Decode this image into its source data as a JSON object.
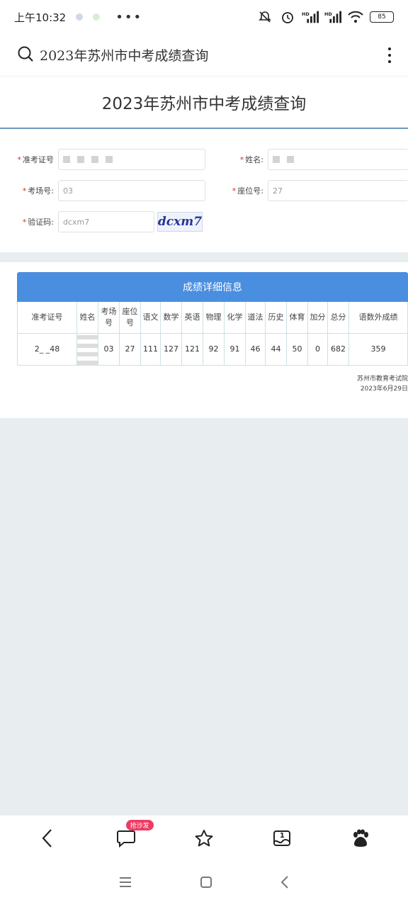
{
  "status": {
    "time": "上午10:32",
    "battery": "85"
  },
  "search": {
    "query": "2023年苏州市中考成绩查询"
  },
  "page": {
    "title": "2023年苏州市中考成绩查询"
  },
  "form": {
    "ticket_label": "准考证号",
    "name_label": "姓名:",
    "room_label": "考场号:",
    "room_value": "03",
    "seat_label": "座位号:",
    "seat_value": "27",
    "code_label": "验证码:",
    "code_value": "dcxm7",
    "captcha_text": "dcxm7",
    "required_mark": "*"
  },
  "result": {
    "header": "成绩详细信息",
    "columns": [
      {
        "label": "准考证号",
        "value": "2_ _48"
      },
      {
        "label": "姓名",
        "value": ""
      },
      {
        "label": "考场号",
        "value": "03"
      },
      {
        "label": "座位号",
        "value": "27"
      },
      {
        "label": "语文",
        "value": "111"
      },
      {
        "label": "数学",
        "value": "127"
      },
      {
        "label": "英语",
        "value": "121"
      },
      {
        "label": "物理",
        "value": "92"
      },
      {
        "label": "化学",
        "value": "91"
      },
      {
        "label": "道法",
        "value": "46"
      },
      {
        "label": "历史",
        "value": "44"
      },
      {
        "label": "体育",
        "value": "50"
      },
      {
        "label": "加分",
        "value": "0"
      },
      {
        "label": "总分",
        "value": "682"
      },
      {
        "label": "语数外成绩",
        "value": "359"
      }
    ],
    "footer_org": "苏州市教育考试院",
    "footer_date": "2023年6月29日"
  },
  "bottom": {
    "badge": "抢沙发",
    "tab_count": "1"
  },
  "colors": {
    "accent": "#4a8ee0",
    "badge": "#ee3b63",
    "required": "#c0392b"
  }
}
